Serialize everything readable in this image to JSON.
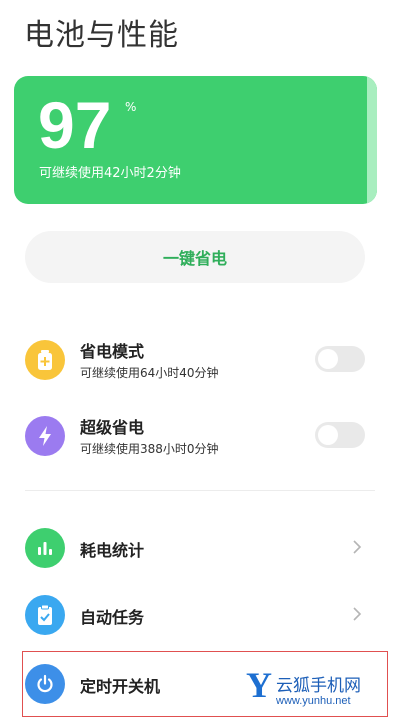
{
  "page": {
    "title": "电池与性能"
  },
  "battery": {
    "level": "97",
    "unit": "%",
    "remaining": "可继续使用42小时2分钟",
    "level_fraction": 0.97
  },
  "one_key": {
    "label": "一键省电"
  },
  "modes": [
    {
      "title": "省电模式",
      "subtitle": "可继续使用64小时40分钟",
      "icon": "battery-plus-icon",
      "color": "#f9c53a",
      "enabled": false
    },
    {
      "title": "超级省电",
      "subtitle": "可继续使用388小时0分钟",
      "icon": "lightning-icon",
      "color": "#9b7bf0",
      "enabled": false
    }
  ],
  "menu": [
    {
      "title": "耗电统计",
      "icon": "bar-chart-icon",
      "color": "#3ecf6f"
    },
    {
      "title": "自动任务",
      "icon": "clipboard-check-icon",
      "color": "#3aa8f0"
    },
    {
      "title": "定时开关机",
      "icon": "power-icon",
      "color": "#3d8fe8"
    }
  ],
  "watermark": {
    "letter": "Y",
    "name": "云狐手机网",
    "url": "www.yunhu.net"
  },
  "colors": {
    "card_green": "#3ecf6f",
    "button_text_green": "#2fae5a",
    "toggle_off": "#e9e9e9",
    "highlight_red": "#e05050"
  }
}
